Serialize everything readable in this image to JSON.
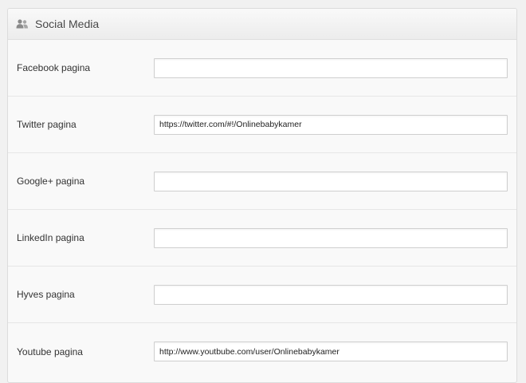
{
  "panel": {
    "title": "Social Media",
    "icon": "users-icon"
  },
  "fields": [
    {
      "label": "Facebook pagina",
      "value": "",
      "placeholder": ""
    },
    {
      "label": "Twitter pagina",
      "value": "https://twitter.com/#!/Onlinebabykamer",
      "placeholder": ""
    },
    {
      "label": "Google+ pagina",
      "value": "",
      "placeholder": ""
    },
    {
      "label": "LinkedIn pagina",
      "value": "",
      "placeholder": ""
    },
    {
      "label": "Hyves pagina",
      "value": "",
      "placeholder": ""
    },
    {
      "label": "Youtube pagina",
      "value": "http://www.youtbube.com/user/Onlinebabykamer",
      "placeholder": ""
    }
  ]
}
